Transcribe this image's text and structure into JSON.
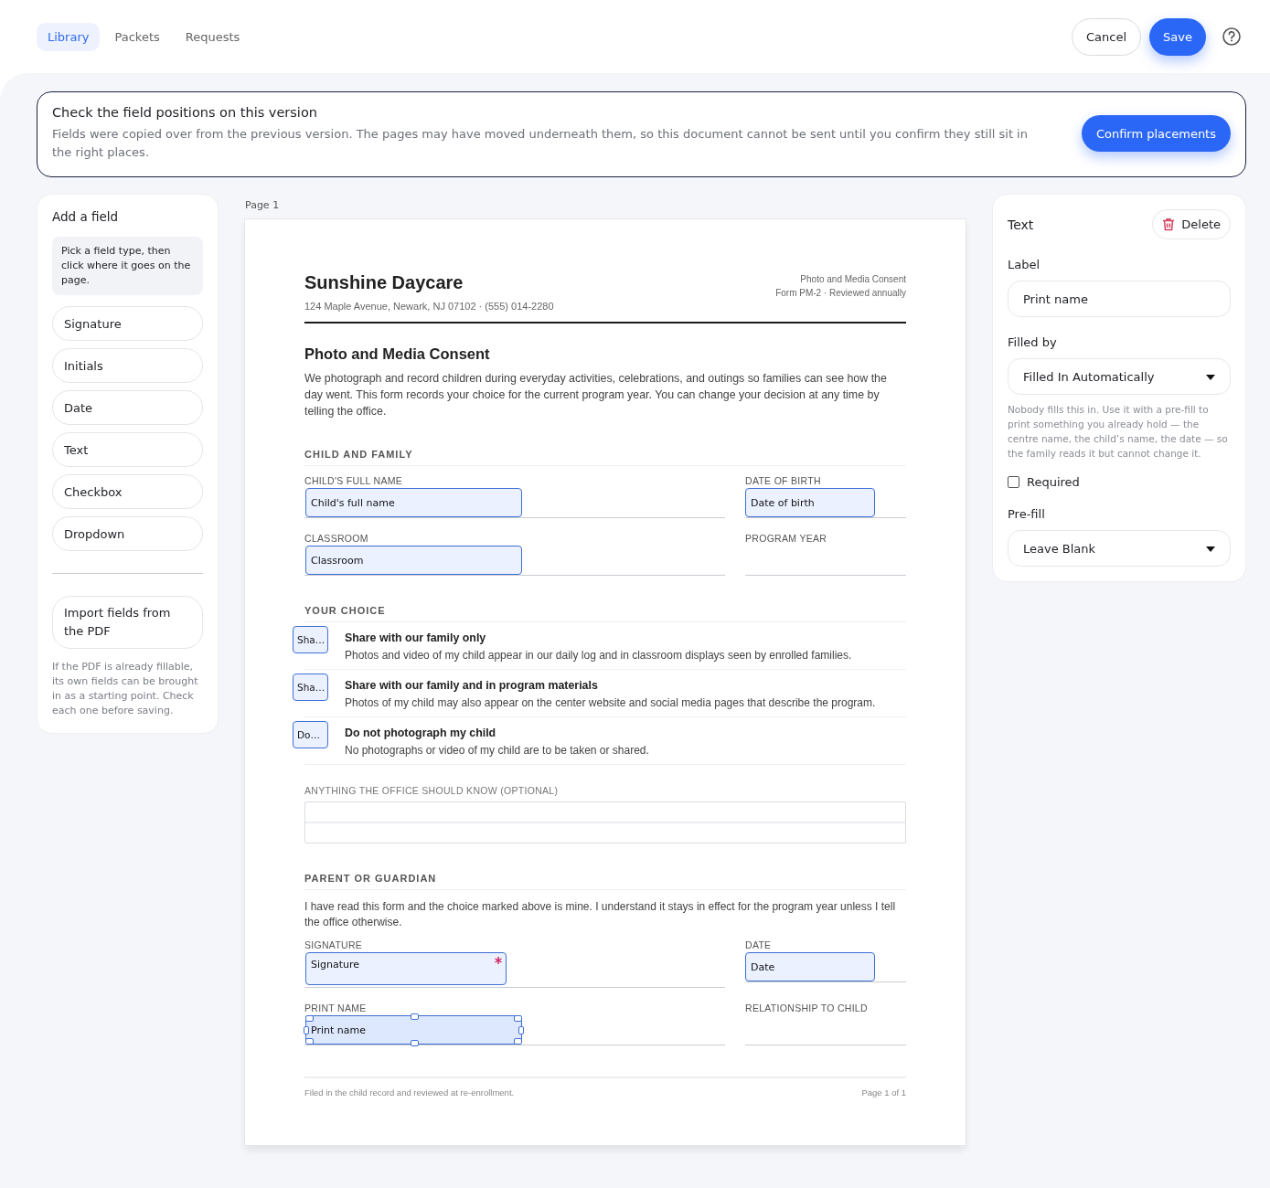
{
  "tabs": [
    {
      "label": "Library",
      "selected": true
    },
    {
      "label": "Packets",
      "selected": false
    },
    {
      "label": "Requests",
      "selected": false
    }
  ],
  "actions": {
    "cancel": "Cancel",
    "save": "Save"
  },
  "banner": {
    "title": "Check the field positions on this version",
    "text": "Fields were copied over from the previous version. The pages may have moved underneath them, so this document cannot be sent until you confirm they still sit in the right places.",
    "button": "Confirm placements"
  },
  "palette": {
    "title": "Add a field",
    "hint": "Pick a field type, then click where it goes on the page.",
    "items": [
      "Signature",
      "Initials",
      "Date",
      "Text",
      "Checkbox",
      "Dropdown"
    ],
    "import_button": "Import fields from the PDF",
    "import_note": "If the PDF is already fillable, its own fields can be brought in as a starting point. Check each one before saving."
  },
  "page_label": "Page 1",
  "document": {
    "org": "Sunshine Daycare",
    "address": "124 Maple Avenue, Newark, NJ 07102  ·  (555) 014-2280",
    "meta": [
      "Photo and Media Consent",
      "Form PM-2  ·  Reviewed annually"
    ],
    "title": "Photo and Media Consent",
    "intro": "We photograph and record children during everyday activities, celebrations, and outings so families can see how the day went. This form records your choice for the current program year. You can change your decision at any time by telling the office.",
    "sections": [
      {
        "kind": "fields",
        "heading": "CHILD AND FAMILY",
        "rows": [
          [
            {
              "label": "CHILD'S FULL NAME",
              "field": {
                "kind": "text",
                "label": "Child's full name",
                "required": false,
                "selected": false
              }
            },
            {
              "label": "DATE OF BIRTH",
              "field": {
                "kind": "date",
                "label": "Date of birth",
                "required": false,
                "selected": false
              }
            }
          ],
          [
            {
              "label": "CLASSROOM",
              "field": {
                "kind": "text",
                "label": "Classroom",
                "required": false,
                "selected": false
              }
            },
            {
              "label": "PROGRAM YEAR"
            }
          ]
        ]
      },
      {
        "kind": "choices",
        "heading": "YOUR CHOICE",
        "choices": [
          {
            "title": "Share with our family only",
            "text": "Photos and video of my child appear in our daily log and in classroom displays seen by enrolled families.",
            "field": {
              "kind": "checkbox",
              "label": "Sha…",
              "selected": false
            }
          },
          {
            "title": "Share with our family and in program materials",
            "text": "Photos of my child may also appear on the center website and social media pages that describe the program.",
            "field": {
              "kind": "checkbox",
              "label": "Sha…",
              "selected": false
            }
          },
          {
            "title": "Do not photograph my child",
            "text": "No photographs or video of my child are to be taken or shared.",
            "field": {
              "kind": "checkbox",
              "label": "Do…",
              "selected": false
            }
          }
        ]
      },
      {
        "kind": "notes",
        "label": "ANYTHING THE OFFICE SHOULD KNOW (OPTIONAL)"
      },
      {
        "kind": "fields",
        "heading": "PARENT OR GUARDIAN",
        "text": "I have read this form and the choice marked above is mine. I understand it stays in effect for the program year unless I tell the office otherwise.",
        "rows": [
          [
            {
              "label": "SIGNATURE",
              "field": {
                "kind": "signature",
                "label": "Signature",
                "required": true,
                "selected": false
              }
            },
            {
              "label": "DATE",
              "field": {
                "kind": "date",
                "label": "Date",
                "required": false,
                "selected": false
              }
            }
          ],
          [
            {
              "label": "PRINT NAME",
              "field": {
                "kind": "text",
                "label": "Print name",
                "required": false,
                "selected": true
              }
            },
            {
              "label": "RELATIONSHIP TO CHILD"
            }
          ]
        ]
      }
    ],
    "footer": {
      "left": "Filed in the child record and reviewed at re-enrollment.",
      "right": "Page 1 of 1"
    }
  },
  "inspector": {
    "title": "Text",
    "delete": "Delete",
    "label_caption": "Label",
    "label_value": "Print name",
    "filled_by_caption": "Filled by",
    "filled_by_value": "Filled In Automatically",
    "help": "Nobody fills this in. Use it with a pre-fill to print something you already hold — the centre name, the child’s name, the date — so the family reads it but cannot change it.",
    "required": {
      "label": "Required",
      "checked": false
    },
    "prefill_caption": "Pre-fill",
    "prefill_value": "Leave Blank"
  }
}
